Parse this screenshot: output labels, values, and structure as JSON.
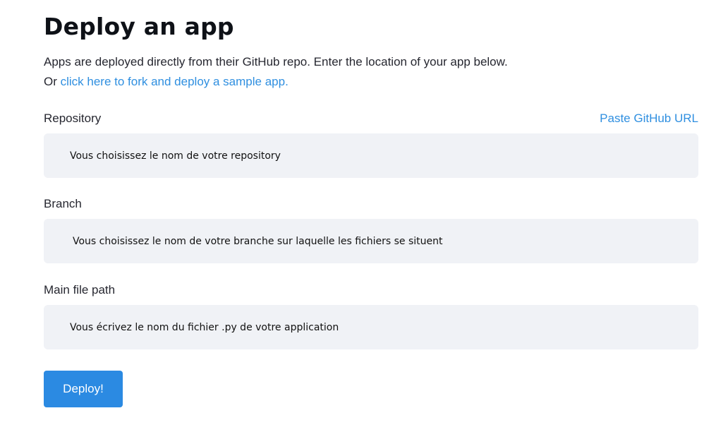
{
  "header": {
    "title": "Deploy an app",
    "intro_line1": "Apps are deployed directly from their GitHub repo. Enter the location of your app below.",
    "intro_line2_prefix": "Or ",
    "intro_link": "click here to fork and deploy a sample app."
  },
  "fields": {
    "repository": {
      "label": "Repository",
      "aux_link": "Paste GitHub URL",
      "value": "Vous choisissez le nom de votre repository"
    },
    "branch": {
      "label": "Branch",
      "value": "Vous choisissez le nom de votre branche sur laquelle les fichiers se situent"
    },
    "main_file": {
      "label": "Main file path",
      "value": "Vous écrivez le nom du fichier .py de votre application"
    }
  },
  "actions": {
    "deploy_label": "Deploy!"
  },
  "colors": {
    "link": "#2f8fe0",
    "field_background": "#f0f2f6",
    "button_primary": "#2b8ae2"
  }
}
